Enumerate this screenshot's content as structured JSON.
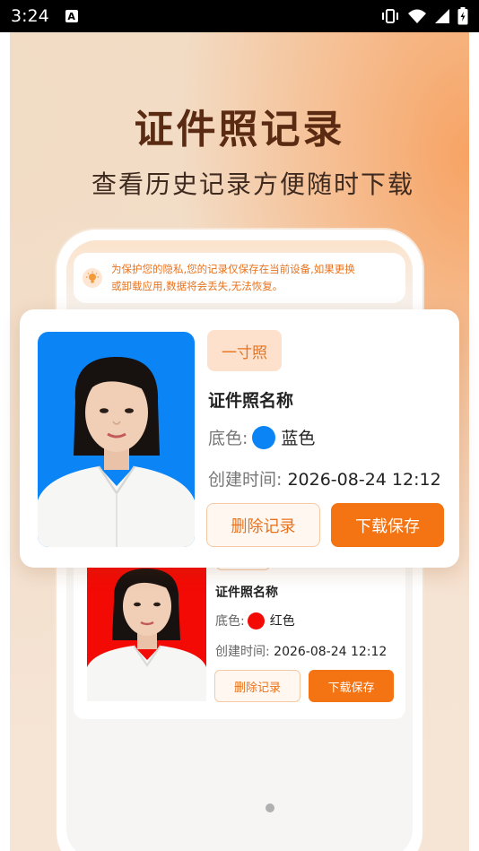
{
  "status_bar": {
    "time": "3:24",
    "notification_icon": "a-icon",
    "icons": [
      "vibrate-icon",
      "wifi-icon",
      "signal-icon",
      "battery-icon"
    ]
  },
  "hero": {
    "title": "证件照记录",
    "subtitle": "查看历史记录方便随时下载"
  },
  "notice": {
    "icon": "lightbulb-icon",
    "line1": "为保护您的隐私,您的记录仅保存在当前设备,如果更换",
    "line2": "或卸载应用,数据将会丢失,无法恢复。"
  },
  "records": [
    {
      "tag": "一寸照",
      "name": "证件照名称",
      "color_label": "底色:",
      "color_name": "蓝色",
      "color_hex": "#0b84f6",
      "time_label": "创建时间:",
      "time_value": "2026-08-24 12:12",
      "delete_label": "删除记录",
      "download_label": "下载保存"
    },
    {
      "name": "证件照名称",
      "color_label": "底色:",
      "color_name": "红色",
      "color_hex": "#f40a05",
      "time_label": "创建时间:",
      "time_value": "2026-08-24 12:12",
      "delete_label": "删除记录",
      "download_label": "下载保存"
    }
  ],
  "colors": {
    "accent": "#f47312",
    "title_brown": "#5a2a12",
    "notice_text": "#e8731e"
  }
}
